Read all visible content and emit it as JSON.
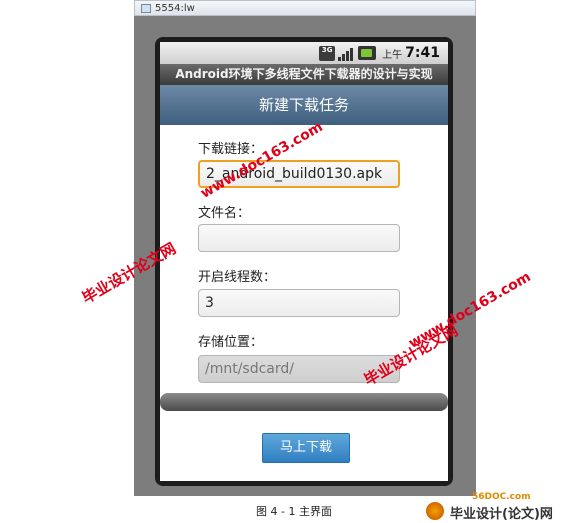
{
  "window": {
    "title": "5554:lw"
  },
  "status_bar": {
    "network": "3G",
    "ampm": "上午",
    "time": "7:41"
  },
  "app": {
    "title": "Android环境下多线程文件下载器的设计与实现",
    "header": "新建下载任务"
  },
  "form": {
    "url_label": "下载链接：",
    "url_value": "2_android_build0130.apk",
    "filename_label": "文件名：",
    "filename_value": "",
    "threads_label": "开启线程数：",
    "threads_value": "3",
    "location_label": "存储位置：",
    "location_value": "/mnt/sdcard/",
    "submit_label": "马上下载"
  },
  "watermarks": {
    "site_cn": "毕业设计论文网",
    "site_url": "www.doc163.com"
  },
  "caption": "图 4 - 1 主界面",
  "footer_brand": {
    "badge": "56DOC.com",
    "name": "毕业设计(论文)网"
  }
}
